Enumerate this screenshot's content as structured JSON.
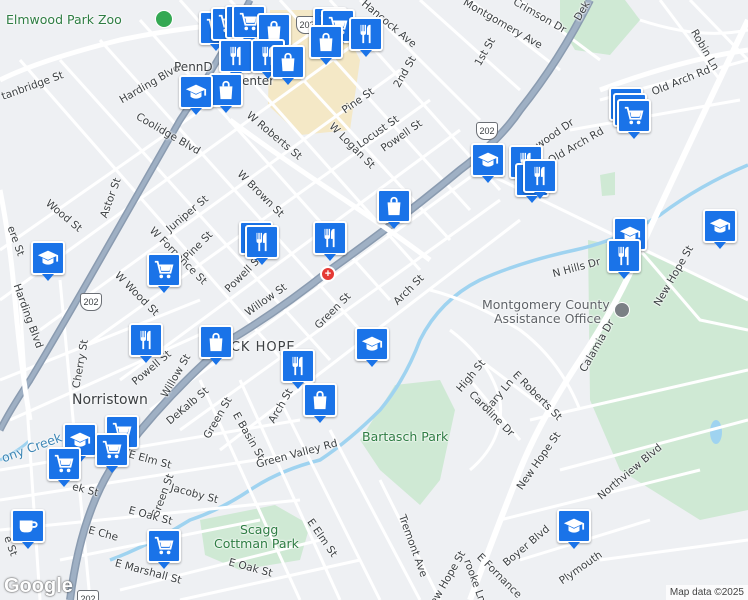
{
  "map": {
    "attribution": "Map data ©2025",
    "logo": "Google",
    "markers": {
      "restaurant_color": "#1a73e8",
      "icons": [
        "restaurant-icon",
        "shopping-bag-icon",
        "grocery-cart-icon",
        "school-icon",
        "cafe-icon"
      ]
    },
    "places": {
      "zoo": "Elmwood Park Zoo",
      "town": "Norristown",
      "partial_place": "ICK HOPE",
      "bartasch_park": "Bartasch Park",
      "scagg_park_line1": "Scagg",
      "scagg_park_line2": "Cottman Park",
      "office_line1": "Montgomery County",
      "office_line2": "Assistance Office",
      "penndot_partial": "PennD",
      "center_partial": "enter",
      "creek": "Stony Creek",
      "creek_partial": "ony Creek"
    },
    "routes": {
      "r202": "202",
      "r202b": "202",
      "r202c": "202",
      "r202d": "202"
    },
    "streets": {
      "montgomery_ave": "Montgomery Ave",
      "crimson_dr": "Crimson Dr",
      "first_st": "1st St",
      "second_st": "2nd St",
      "hancock_ave": "Hancock Ave",
      "robin_ln": "Robin Ln",
      "old_arch_rd": "Old Arch Rd",
      "harding_blvd_top": "Harding Blvd",
      "harding_blvd_left": "Harding Blvd",
      "coolidge_blvd": "Coolidge Blvd",
      "w_roberts_st": "W Roberts St",
      "pine_st_top": "Pine St",
      "locust_st": "Locust St",
      "w_logan_st": "W Logan St",
      "powell_st_top": "Powell St",
      "wood_dr": "wood Dr",
      "old_arch_rd_mid": "Old Arch Rd",
      "dekalb_st_top": "Dek",
      "juniper_st": "Juniper St",
      "w_brown_st": "W Brown St",
      "w_fornance_st": "W Fornance St",
      "pine_st": "Pine St",
      "powell_st_mid": "Powell St",
      "willow_st": "Willow St",
      "wood_st": "Wood St",
      "astor_st": "Astor St",
      "w_wood_st": "W Wood St",
      "cherry_st": "Cherry St",
      "powell_st_low": "Powell St",
      "willow_st_low": "Willow St",
      "green_st": "Green St",
      "arch_st": "Arch St",
      "n_hills_dr": "N Hills Dr",
      "new_hope_st_upper": "New Hope St",
      "calamia_dr": "Calamia Dr",
      "high_st": "High St",
      "gary_ln": "Gary Ln",
      "e_roberts_st": "E Roberts St",
      "caroline_dr": "Caroline Dr",
      "new_hope_st_lower": "New Hope St",
      "northview_blvd": "Northview Blvd",
      "dekalb_st": "DeKalb St",
      "green_st_low": "Green St",
      "e_basin_st": "E Basin St",
      "arch_st_low": "Arch St",
      "green_valley_rd": "Green Valley Rd",
      "e_elm_st": "E Elm St",
      "jacoby_st": "Jacoby St",
      "e_oak_st": "E Oak St",
      "e_chestnut": "E Che",
      "e_marshall_st": "E Marshall St",
      "e_elm_st_low": "E Elm St",
      "e_oak_st_low": "E Oak St",
      "tremont_ave": "Tremont Ave",
      "new_hope_st_bottom": "ew Hope St",
      "boyer_blvd": "Boyer Blvd",
      "plymouth": "Plymouth",
      "e_fornance": "E Fornance",
      "brooke_ln": "rooke Ln",
      "stanbridge_st": "tanbridge St",
      "green_st_left": "Green St",
      "ere_st": "ere St",
      "e_st": "e St",
      "ek_st": "ek St",
      "tremont": "Tremont Ave"
    }
  }
}
